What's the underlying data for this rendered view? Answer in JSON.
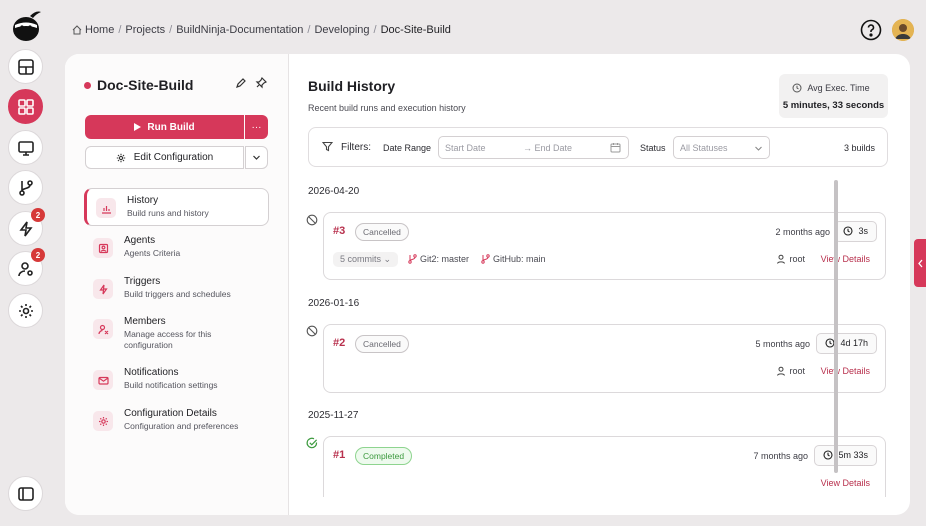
{
  "breadcrumb": [
    "Home",
    "Projects",
    "BuildNinja-Documentation",
    "Developing",
    "Doc-Site-Build"
  ],
  "rail": {
    "badges": {
      "triggers": "2",
      "users": "2"
    }
  },
  "sidebar": {
    "title": "Doc-Site-Build",
    "run_label": "Run Build",
    "more_label": "···",
    "edit_label": "Edit Configuration",
    "items": [
      {
        "label": "History",
        "desc": "Build runs and history"
      },
      {
        "label": "Agents",
        "desc": "Agents Criteria"
      },
      {
        "label": "Triggers",
        "desc": "Build triggers and schedules"
      },
      {
        "label": "Members",
        "desc": "Manage access for this configuration"
      },
      {
        "label": "Notifications",
        "desc": "Build notification settings"
      },
      {
        "label": "Configuration Details",
        "desc": "Configuration and preferences"
      }
    ]
  },
  "main": {
    "title": "Build History",
    "subtitle": "Recent build runs and execution history",
    "avg_label": "Avg Exec. Time",
    "avg_value": "5 minutes, 33 seconds",
    "filters": {
      "label": "Filters:",
      "date_range_label": "Date Range",
      "start_placeholder": "Start Date",
      "arrow": "→",
      "end_placeholder": "End Date",
      "status_label": "Status",
      "status_value": "All Statuses",
      "count": "3 builds"
    },
    "groups": [
      {
        "date": "2026-04-20",
        "build": {
          "number": "#3",
          "status": "Cancelled",
          "ago": "2 months ago",
          "duration": "3s",
          "commits": "5 commits",
          "branches": [
            "Git2: master",
            "GitHub: main"
          ],
          "user": "root",
          "details": "View Details"
        }
      },
      {
        "date": "2026-01-16",
        "build": {
          "number": "#2",
          "status": "Cancelled",
          "ago": "5 months ago",
          "duration": "4d 17h",
          "user": "root",
          "details": "View Details"
        }
      },
      {
        "date": "2025-11-27",
        "build": {
          "number": "#1",
          "status": "Completed",
          "ago": "7 months ago",
          "duration": "5m 33s",
          "details": "View Details"
        }
      }
    ]
  },
  "colors": {
    "accent": "#d6385a",
    "accent_dark": "#b8304d",
    "success": "#3c9a3e"
  }
}
